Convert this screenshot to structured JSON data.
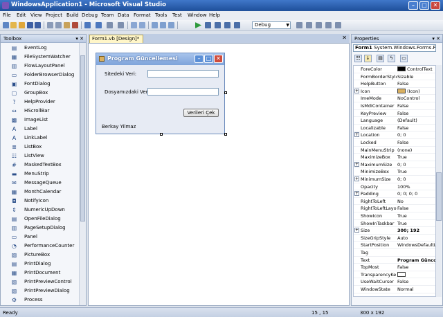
{
  "window": {
    "title": "WindowsApplication1 - Microsoft Visual Studio",
    "min": "–",
    "max": "□",
    "close": "✕"
  },
  "menu": [
    "File",
    "Edit",
    "View",
    "Project",
    "Build",
    "Debug",
    "Team",
    "Data",
    "Format",
    "Tools",
    "Test",
    "Window",
    "Help"
  ],
  "toolbar": {
    "config_value": "Debug"
  },
  "toolbox": {
    "title": "Toolbox",
    "controls": "▾ ✕",
    "items": [
      {
        "label": "EventLog",
        "icon": "event-log-icon",
        "glyph": "▤"
      },
      {
        "label": "FileSystemWatcher",
        "icon": "file-watcher-icon",
        "glyph": "▦"
      },
      {
        "label": "FlowLayoutPanel",
        "icon": "flow-panel-icon",
        "glyph": "▥"
      },
      {
        "label": "FolderBrowserDialog",
        "icon": "folder-icon",
        "glyph": "▭"
      },
      {
        "label": "FontDialog",
        "icon": "font-dialog-icon",
        "glyph": "▣"
      },
      {
        "label": "GroupBox",
        "icon": "group-box-icon",
        "glyph": "▢"
      },
      {
        "label": "HelpProvider",
        "icon": "help-icon",
        "glyph": "?"
      },
      {
        "label": "HScrollBar",
        "icon": "hscroll-icon",
        "glyph": "↔"
      },
      {
        "label": "ImageList",
        "icon": "image-list-icon",
        "glyph": "▩"
      },
      {
        "label": "Label",
        "icon": "label-icon",
        "glyph": "A"
      },
      {
        "label": "LinkLabel",
        "icon": "link-label-icon",
        "glyph": "A"
      },
      {
        "label": "ListBox",
        "icon": "listbox-icon",
        "glyph": "≣"
      },
      {
        "label": "ListView",
        "icon": "listview-icon",
        "glyph": "☷"
      },
      {
        "label": "MaskedTextBox",
        "icon": "masked-text-icon",
        "glyph": "#"
      },
      {
        "label": "MenuStrip",
        "icon": "menu-strip-icon",
        "glyph": "▬"
      },
      {
        "label": "MessageQueue",
        "icon": "message-queue-icon",
        "glyph": "✉"
      },
      {
        "label": "MonthCalendar",
        "icon": "calendar-icon",
        "glyph": "▦"
      },
      {
        "label": "NotifyIcon",
        "icon": "notify-icon",
        "glyph": "◘"
      },
      {
        "label": "NumericUpDown",
        "icon": "numeric-icon",
        "glyph": "⇕"
      },
      {
        "label": "OpenFileDialog",
        "icon": "open-file-icon",
        "glyph": "▤"
      },
      {
        "label": "PageSetupDialog",
        "icon": "page-setup-icon",
        "glyph": "▥"
      },
      {
        "label": "Panel",
        "icon": "panel-icon",
        "glyph": "▭"
      },
      {
        "label": "PerformanceCounter",
        "icon": "perf-counter-icon",
        "glyph": "◔"
      },
      {
        "label": "PictureBox",
        "icon": "picture-icon",
        "glyph": "▨"
      },
      {
        "label": "PrintDialog",
        "icon": "print-dialog-icon",
        "glyph": "▤"
      },
      {
        "label": "PrintDocument",
        "icon": "print-doc-icon",
        "glyph": "▦"
      },
      {
        "label": "PrintPreviewControl",
        "icon": "print-preview-icon",
        "glyph": "▧"
      },
      {
        "label": "PrintPreviewDialog",
        "icon": "print-preview-dialog-icon",
        "glyph": "▧"
      },
      {
        "label": "Process",
        "icon": "process-icon",
        "glyph": "⚙"
      }
    ]
  },
  "document": {
    "tab_label": "Form1.vb [Design]*",
    "tab_close": "✕",
    "form": {
      "title": "Program Güncellemesi",
      "label1": "Sitedeki Veri:",
      "label2": "Dosyamızdaki Veri:",
      "button": "Verileri Çek",
      "footer": "Berkay Yilmaz"
    }
  },
  "properties": {
    "title": "Properties",
    "controls": "▾ ✕",
    "object": "Form1",
    "object_type": "System.Windows.Forms.Form",
    "rows": [
      {
        "name": "ForeColor",
        "value": "ControlText",
        "swatch": "#000000"
      },
      {
        "name": "FormBorderStyle",
        "value": "Sizable"
      },
      {
        "name": "HelpButton",
        "value": "False"
      },
      {
        "name": "Icon",
        "value": "(Icon)",
        "expand": true,
        "swatch": "#d9b060"
      },
      {
        "name": "ImeMode",
        "value": "NoControl"
      },
      {
        "name": "IsMdiContainer",
        "value": "False"
      },
      {
        "name": "KeyPreview",
        "value": "False"
      },
      {
        "name": "Language",
        "value": "(Default)"
      },
      {
        "name": "Localizable",
        "value": "False"
      },
      {
        "name": "Location",
        "value": "0; 0",
        "expand": true
      },
      {
        "name": "Locked",
        "value": "False"
      },
      {
        "name": "MainMenuStrip",
        "value": "(none)"
      },
      {
        "name": "MaximizeBox",
        "value": "True"
      },
      {
        "name": "MaximumSize",
        "value": "0; 0",
        "expand": true
      },
      {
        "name": "MinimizeBox",
        "value": "True"
      },
      {
        "name": "MinimumSize",
        "value": "0; 0",
        "expand": true
      },
      {
        "name": "Opacity",
        "value": "100%"
      },
      {
        "name": "Padding",
        "value": "0; 0; 0; 0",
        "expand": true
      },
      {
        "name": "RightToLeft",
        "value": "No"
      },
      {
        "name": "RightToLeftLayo",
        "value": "False"
      },
      {
        "name": "ShowIcon",
        "value": "True"
      },
      {
        "name": "ShowInTaskbar",
        "value": "True"
      },
      {
        "name": "Size",
        "value": "300; 192",
        "expand": true,
        "bold": true
      },
      {
        "name": "SizeGripStyle",
        "value": "Auto"
      },
      {
        "name": "StartPosition",
        "value": "WindowsDefaultL"
      },
      {
        "name": "Tag",
        "value": ""
      },
      {
        "name": "Text",
        "value": "Program Güncc",
        "bold": true
      },
      {
        "name": "TopMost",
        "value": "False"
      },
      {
        "name": "TransparencyKe",
        "value": "",
        "swatch": "#ffffff"
      },
      {
        "name": "UseWaitCursor",
        "value": "False"
      },
      {
        "name": "WindowState",
        "value": "Normal"
      }
    ]
  },
  "status": {
    "ready": "Ready",
    "position": "15 , 15",
    "size": "300 x 192"
  }
}
